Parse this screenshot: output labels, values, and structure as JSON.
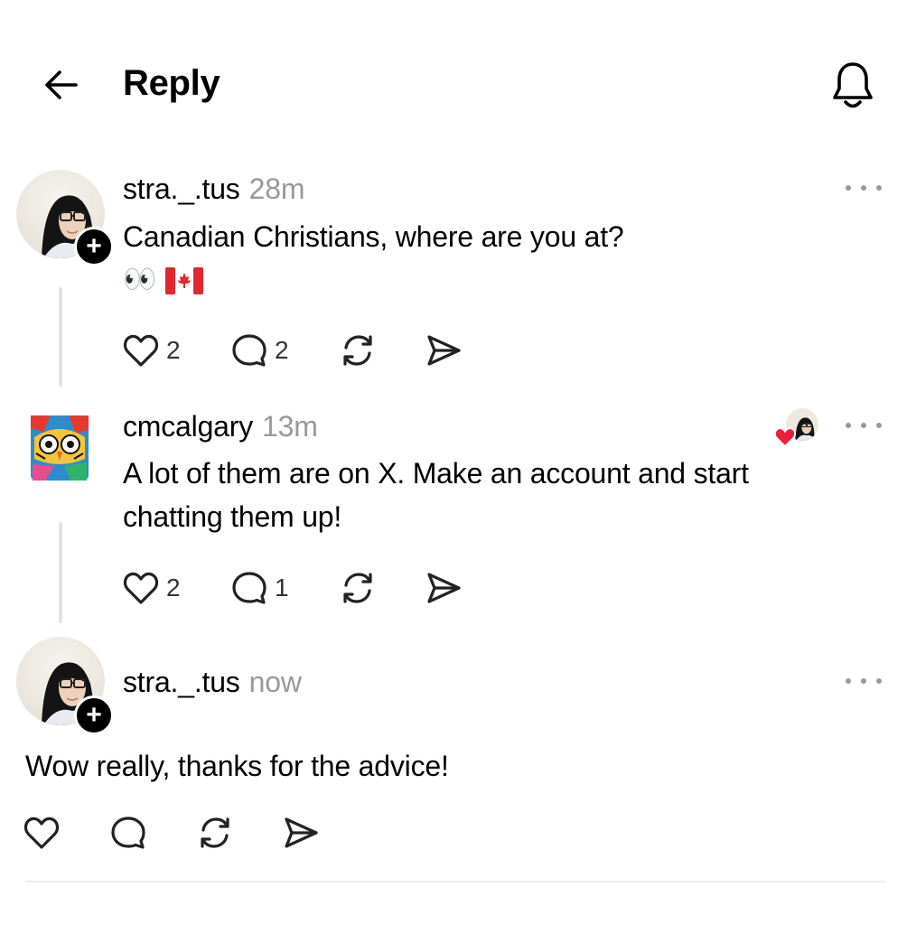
{
  "header": {
    "title": "Reply"
  },
  "posts": [
    {
      "username": "stra._.tus",
      "time": "28m",
      "text": "Canadian Christians, where are you at?",
      "emoji": "👀",
      "likes": "2",
      "replies": "2"
    },
    {
      "username": "cmcalgary",
      "time": "13m",
      "text_line1": "A lot of them are on X. Make an account and start",
      "text_line2": "chatting them up!",
      "likes": "2",
      "replies": "1"
    },
    {
      "username": "stra._.tus",
      "time": "now",
      "text": "Wow really, thanks for the advice!"
    }
  ],
  "colors": {
    "like_heart": "#ee1d3a",
    "thread_line": "#e3e3e3",
    "time_gray": "#999999"
  }
}
